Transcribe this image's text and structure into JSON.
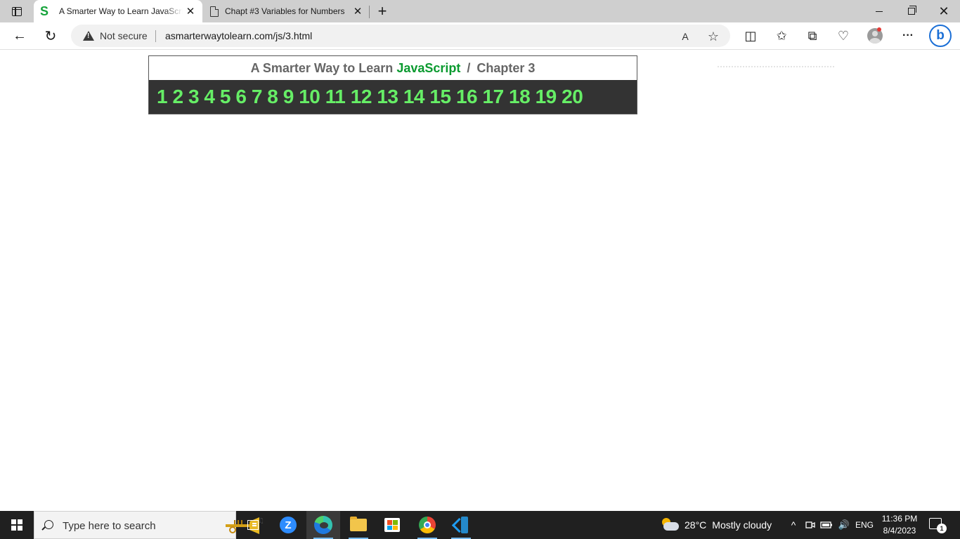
{
  "browser": {
    "tabs": [
      {
        "title": "A Smarter Way to Learn JavaScript",
        "favicon": "S",
        "active": true
      },
      {
        "title": "Chapt #3 Variables for Numbers",
        "active": false
      }
    ],
    "address": {
      "security_label": "Not secure",
      "url": "asmarterwaytolearn.com/js/3.html"
    },
    "icons": {
      "close": "✕",
      "new_tab": "+",
      "back": "←",
      "refresh": "↻",
      "read_aloud": "A",
      "favorite": "☆",
      "split_screen": "◫",
      "favorites": "✩",
      "collections": "⧉",
      "performance": "♡",
      "more": "···",
      "bing": "b",
      "win_close": "✕"
    }
  },
  "page": {
    "title_prefix": "A Smarter Way to Learn",
    "title_highlight": "JavaScript",
    "title_separator": "/",
    "chapter_label": "Chapter 3",
    "chapter_numbers": [
      "1",
      "2",
      "3",
      "4",
      "5",
      "6",
      "7",
      "8",
      "9",
      "10",
      "11",
      "12",
      "13",
      "14",
      "15",
      "16",
      "17",
      "18",
      "19",
      "20"
    ],
    "colors": {
      "accent": "#0a9a2f",
      "numbers": "#66ee66",
      "numbers_bg": "#333333"
    }
  },
  "taskbar": {
    "search_placeholder": "Type here to search",
    "weather": {
      "temperature": "28°C",
      "condition": "Mostly cloudy"
    },
    "language": "ENG",
    "time": "11:36 PM",
    "date": "8/4/2023",
    "notification_count": "1",
    "tray": {
      "chevron": "^",
      "volume": "🔊"
    }
  }
}
